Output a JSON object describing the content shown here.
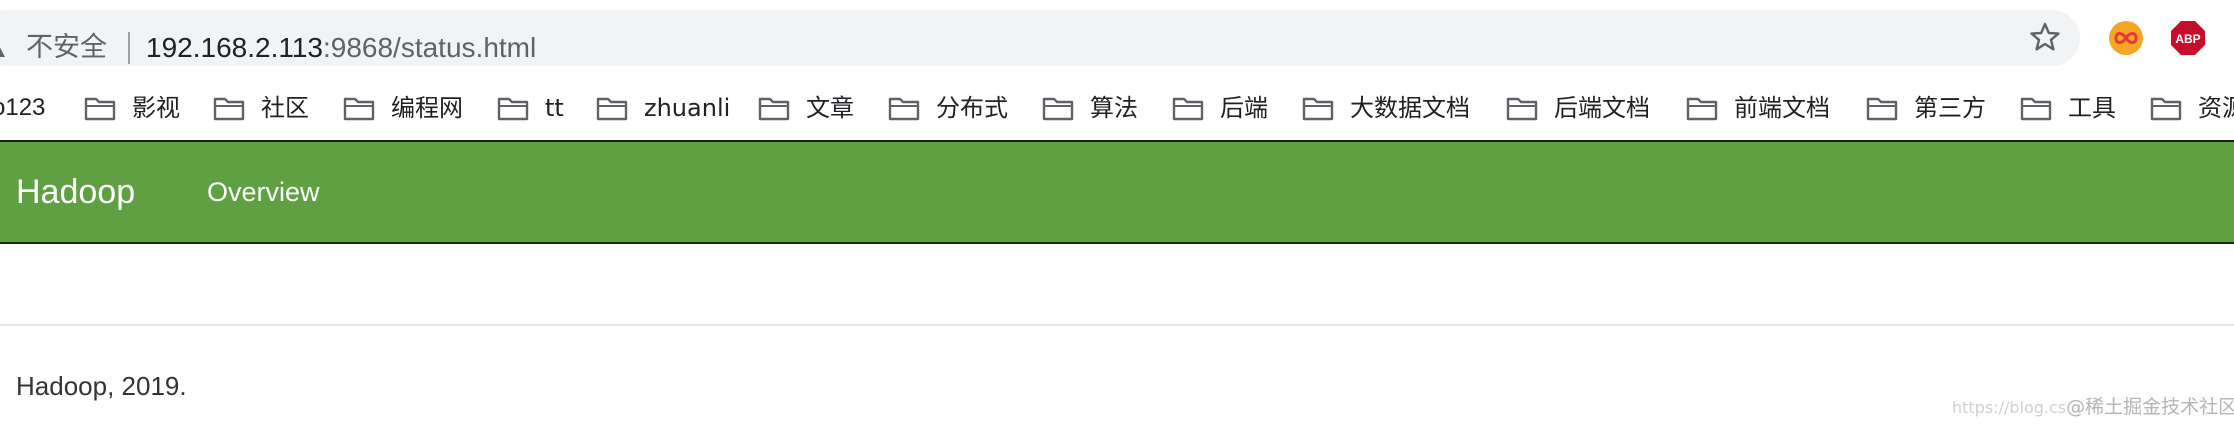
{
  "browser": {
    "security_label": "不安全",
    "url_host": "192.168.2.113",
    "url_rest": ":9868/status.html"
  },
  "bookmarks": {
    "first_partial": "o123",
    "items": [
      {
        "label": "影视"
      },
      {
        "label": "社区"
      },
      {
        "label": "编程网"
      },
      {
        "label": "tt"
      },
      {
        "label": "zhuanli"
      },
      {
        "label": "文章"
      },
      {
        "label": "分布式"
      },
      {
        "label": "算法"
      },
      {
        "label": "后端"
      },
      {
        "label": "大数据文档"
      },
      {
        "label": "后端文档"
      },
      {
        "label": "前端文档"
      },
      {
        "label": "第三方"
      },
      {
        "label": "工具"
      },
      {
        "label": "资源"
      }
    ]
  },
  "page": {
    "brand": "Hadoop",
    "nav_overview": "Overview",
    "footer": "Hadoop, 2019."
  },
  "watermark": {
    "url": "https://blog.cs",
    "text": "@稀土掘金技术社区"
  },
  "colors": {
    "navbar": "#5fa142",
    "omnibox": "#f1f3f4",
    "abp_red": "#c70d2c",
    "infinity_orange": "#f5a623"
  },
  "icons": {
    "security": "warning-triangle-icon",
    "star": "bookmark-star-icon",
    "extension_1": "infinity-extension-icon",
    "extension_2": "adblock-plus-icon",
    "bookmark_folder": "folder-icon"
  }
}
